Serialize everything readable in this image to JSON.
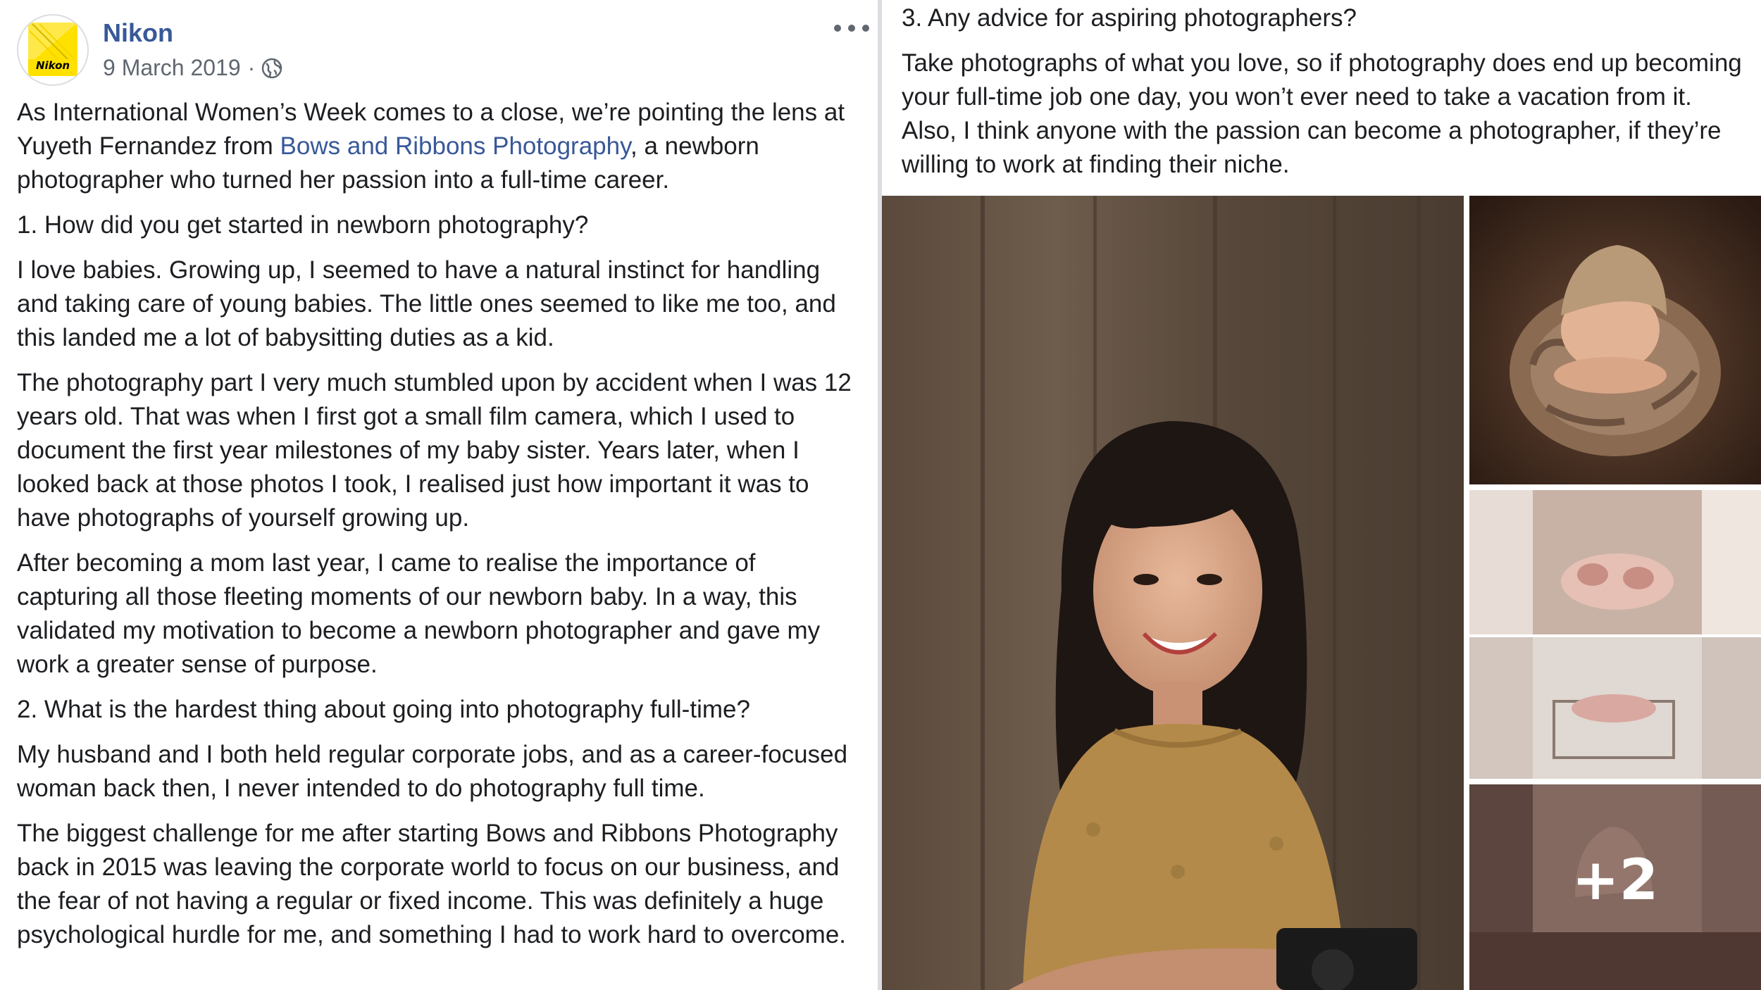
{
  "post": {
    "page_name": "Nikon",
    "date": "9 March 2019",
    "separator": "·",
    "avatar_logo_text": "Nikon",
    "privacy_icon": "globe-icon",
    "more_icon": "more-options-icon",
    "paragraphs": [
      {
        "before_link": "As International Women’s Week comes to a close, we’re pointing the lens at Yuyeth Fernandez from ",
        "link_text": "Bows and Ribbons Photography",
        "after_link": ", a newborn photographer who turned her passion into a full-time career."
      },
      {
        "text": "1. How did you get started in newborn photography?"
      },
      {
        "text": "I love babies. Growing up, I seemed to have a natural instinct for handling and taking care of young babies. The little ones seemed to like me too, and this landed me a lot of babysitting duties as a kid."
      },
      {
        "text": "The photography part I very much stumbled upon by accident when I was 12 years old. That was when I first got a small film camera, which I used to document the first year milestones of my baby sister. Years later, when I looked back at those photos I took, I realised just how important it was to have photographs of yourself growing up."
      },
      {
        "text": "After becoming a mom last year, I came to realise the importance of capturing all those fleeting moments of our newborn baby. In a way, this validated my motivation to become a newborn photographer and gave my work a greater sense of purpose."
      },
      {
        "text": "2. What is the hardest thing about going into photography full-time?"
      },
      {
        "text": "My husband and I both held regular corporate jobs, and as a career-focused woman back then, I never intended to do photography full time."
      },
      {
        "text": "The biggest challenge for me after starting Bows and Ribbons Photography back in 2015 was leaving the corporate world to focus on our business, and the fear of not having a regular or fixed income. This was definitely a huge psychological hurdle for me, and something I had to work hard to overcome."
      }
    ],
    "right_paragraphs": [
      {
        "text": "3. Any advice for aspiring photographers?"
      },
      {
        "text": "Take photographs of what you love, so if photography does end up becoming your full-time job one day, you won’t ever need to take a vacation from it. Also, I think anyone with the passion can become a photographer, if they’re willing to work at finding their niche."
      }
    ],
    "photos": {
      "more_count": "+2"
    }
  },
  "colors": {
    "link": "#385898",
    "text": "#1c1e21",
    "meta": "#606770",
    "nikon_yellow": "#ffe100"
  }
}
